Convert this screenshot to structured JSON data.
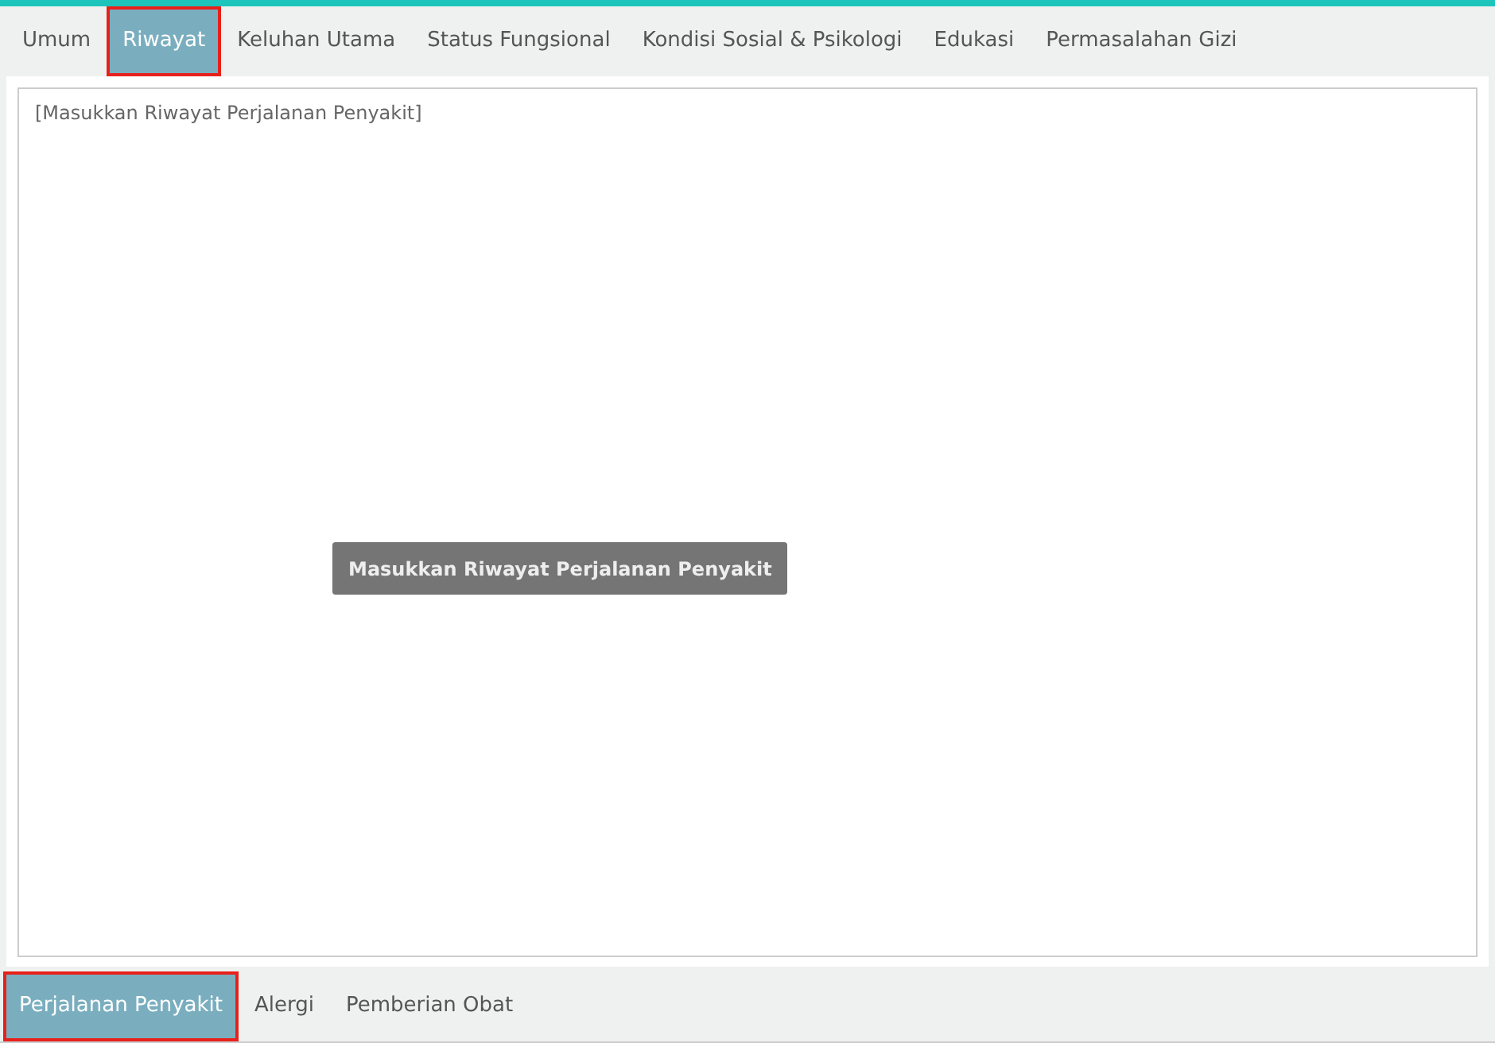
{
  "tabs": [
    {
      "label": "Umum",
      "selected": false
    },
    {
      "label": "Riwayat",
      "selected": true
    },
    {
      "label": "Keluhan Utama",
      "selected": false
    },
    {
      "label": "Status Fungsional",
      "selected": false
    },
    {
      "label": "Kondisi Sosial & Psikologi",
      "selected": false
    },
    {
      "label": "Edukasi",
      "selected": false
    },
    {
      "label": "Permasalahan Gizi",
      "selected": false
    }
  ],
  "editor": {
    "placeholder": "[Masukkan Riwayat Perjalanan Penyakit]"
  },
  "tooltip": "Masukkan Riwayat Perjalanan Penyakit",
  "sub_tabs": [
    {
      "label": "Perjalanan Penyakit",
      "selected": true
    },
    {
      "label": "Alergi",
      "selected": false
    },
    {
      "label": "Pemberian Obat",
      "selected": false
    }
  ]
}
